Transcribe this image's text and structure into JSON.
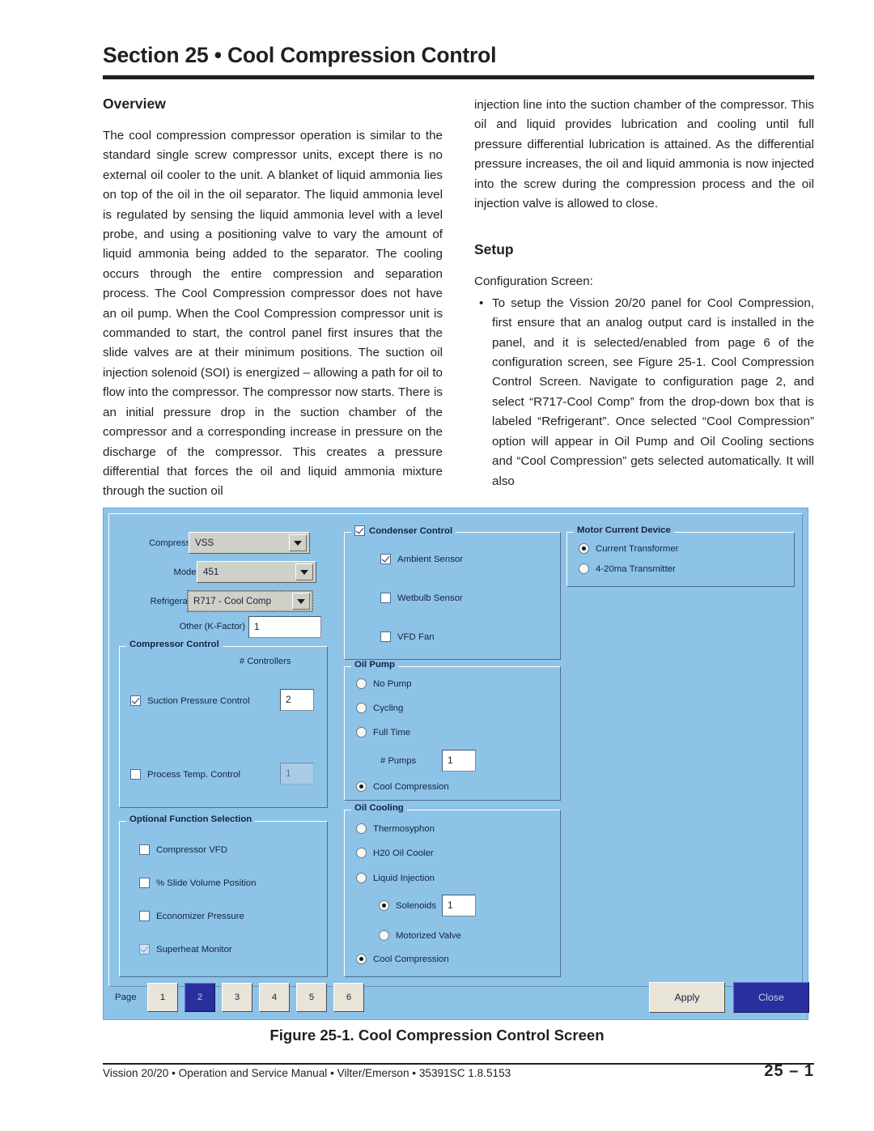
{
  "header": {
    "section_title": "Section 25 • Cool Compression Control"
  },
  "left_column": {
    "heading": "Overview",
    "paragraph": "The cool compression compressor operation is similar to the standard single screw compressor units, except there is no external oil cooler to the unit. A blanket of liquid ammonia lies on top of the oil in the oil separator. The liquid ammonia level is regulated by sensing the liquid ammonia level with a level probe, and using a positioning valve to vary the amount of liquid ammonia being added to the separator. The cooling occurs through the entire compression and separation process. The Cool Compression compressor does not have an oil pump. When the Cool Compression compressor unit is commanded to start, the control panel first insures that the slide valves are at their minimum positions. The suction oil injection solenoid (SOI) is energized – allowing a path for oil to flow into the compressor. The compressor now starts. There is an initial pressure drop in the suction chamber of the compressor and a corresponding increase in pressure on the discharge of the compressor. This creates a pressure differential that forces the oil and liquid ammonia mixture through the suction oil"
  },
  "right_column": {
    "continued_paragraph": "injection line into the suction chamber of the compressor. This oil and liquid provides lubrication and cooling until full pressure differential lubrication is attained. As the differential pressure increases, the oil and liquid ammonia is now injected into the screw during the compression process and the oil injection valve is allowed to close.",
    "heading": "Setup",
    "subhead": "Configuration Screen:",
    "bullets": [
      "To setup the Vission 20/20 panel for Cool Compression, first ensure that an analog output card is installed in the panel, and it is selected/enabled from page 6 of the configuration screen, see Figure 25-1. Cool Compression Control Screen. Navigate to configuration page 2, and select “R717-Cool Comp” from the drop-down box that is labeled “Refrigerant”. Once selected “Cool Compression” option will appear in Oil Pump and Oil Cooling sections and “Cool Compression” gets selected automatically. It will also"
    ]
  },
  "screen": {
    "compressor": {
      "label": "Compressor",
      "value": "VSS"
    },
    "model": {
      "label": "Model",
      "value": "451"
    },
    "refrigerant": {
      "label": "Refrigerant",
      "value": "R717 - Cool Comp"
    },
    "k_factor": {
      "label": "Other (K-Factor)",
      "value": "1"
    },
    "compressor_control": {
      "legend": "Compressor Control",
      "controllers_label": "# Controllers",
      "items": [
        {
          "label": "Suction Pressure Control",
          "checked": true,
          "count": "2",
          "count_disabled": false
        },
        {
          "label": "Process Temp. Control",
          "checked": false,
          "count": "1",
          "count_disabled": true
        }
      ]
    },
    "optional_function": {
      "legend": "Optional Function Selection",
      "items": [
        {
          "label": "Compressor VFD",
          "checked": false,
          "dim": false
        },
        {
          "label": "% Slide Volume Position",
          "checked": false,
          "dim": false
        },
        {
          "label": "Economizer Pressure",
          "checked": false,
          "dim": false
        },
        {
          "label": "Superheat Monitor",
          "checked": true,
          "dim": true
        }
      ]
    },
    "condenser_control": {
      "legend": "Condenser Control",
      "legend_checked": true,
      "items": [
        {
          "label": "Ambient Sensor",
          "checked": true
        },
        {
          "label": "Wetbulb Sensor",
          "checked": false
        },
        {
          "label": "VFD Fan",
          "checked": false
        }
      ]
    },
    "oil_pump": {
      "legend": "Oil Pump",
      "items": [
        {
          "label": "No Pump",
          "selected": false
        },
        {
          "label": "Cycling",
          "selected": false
        },
        {
          "label": "Full Time",
          "selected": false
        },
        {
          "label": "Cool Compression",
          "selected": true
        }
      ],
      "pumps_label": "# Pumps",
      "pumps_value": "1"
    },
    "oil_cooling": {
      "legend": "Oil Cooling",
      "items": [
        {
          "label": "Thermosyphon",
          "selected": false
        },
        {
          "label": "H20 Oil Cooler",
          "selected": false
        },
        {
          "label": "Liquid Injection",
          "selected": false
        },
        {
          "label": "Solenoids",
          "selected": true
        },
        {
          "label": "Motorized Valve",
          "selected": false
        },
        {
          "label": "Cool Compression",
          "selected": true
        }
      ],
      "solenoids_value": "1"
    },
    "motor_current_device": {
      "legend": "Motor Current Device",
      "items": [
        {
          "label": "Current Transformer",
          "selected": true
        },
        {
          "label": "4-20ma Transmitter",
          "selected": false
        }
      ]
    },
    "bottom_bar": {
      "page_label": "Page",
      "pages": [
        "1",
        "2",
        "3",
        "4",
        "5",
        "6"
      ],
      "active_page": "2",
      "apply_label": "Apply",
      "close_label": "Close"
    }
  },
  "figure_caption": "Figure 25-1. Cool Compression Control Screen",
  "footer": {
    "left": "Vission 20/20 • Operation and Service Manual • Vilter/Emerson • 35391SC 1.8.5153",
    "right": "25  –  1"
  }
}
